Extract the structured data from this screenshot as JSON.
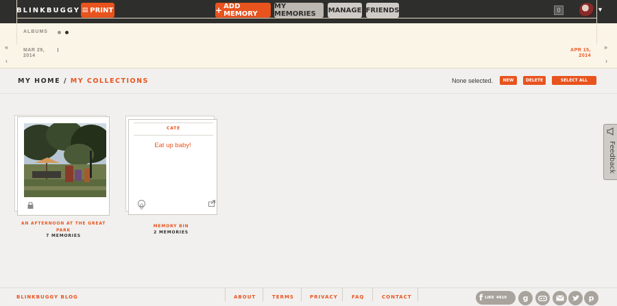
{
  "header": {
    "logo": "BLINKBUGGY",
    "print_label": "PRINT",
    "add_memory_label": "ADD MEMORY",
    "my_memories_label": "MY MEMORIES",
    "manage_label": "MANAGE",
    "friends_label": "FRIENDS",
    "notification_count": "0"
  },
  "timeline": {
    "albums_label": "ALBUMS",
    "start_date": [
      "MAR 29,",
      "2014"
    ],
    "end_date": [
      "APR 15,",
      "2014"
    ],
    "first_arrow": "«",
    "prev_arrow": "‹",
    "last_arrow": "»",
    "next_arrow": "›"
  },
  "breadcrumb": {
    "home": "MY HOME",
    "separator": "/",
    "current": "MY COLLECTIONS"
  },
  "actions": {
    "selection_status": "None selected.",
    "new_label": "NEW",
    "delete_label": "DELETE",
    "select_all_label": "SELECT ALL"
  },
  "collections": [
    {
      "name_line1": "AN AFTERNOON AT THE GREAT",
      "name_line2": "PARK",
      "count": "7 MEMORIES",
      "privacy": "lock-icon"
    },
    {
      "label": "CATE",
      "text": "Eat up baby!",
      "name_line1": "MEMORY BIN",
      "count": "2 MEMORIES",
      "privacy": "globe-icon"
    }
  ],
  "feedback_label": "Feedback",
  "footer": {
    "blog": "BLINKBUGGY BLOG",
    "links": [
      "ABOUT",
      "TERMS",
      "PRIVACY",
      "FAQ",
      "CONTACT"
    ],
    "like_label": "LIKE",
    "like_count": "4910",
    "social": [
      "google-plus-icon",
      "chat-icon",
      "mail-icon",
      "twitter-icon",
      "pinterest-icon"
    ]
  },
  "colors": {
    "accent": "#e8531e",
    "topbar": "#2e2e2c",
    "timeline_bg": "#fbf5e8",
    "page_bg": "#f1f0ee"
  }
}
